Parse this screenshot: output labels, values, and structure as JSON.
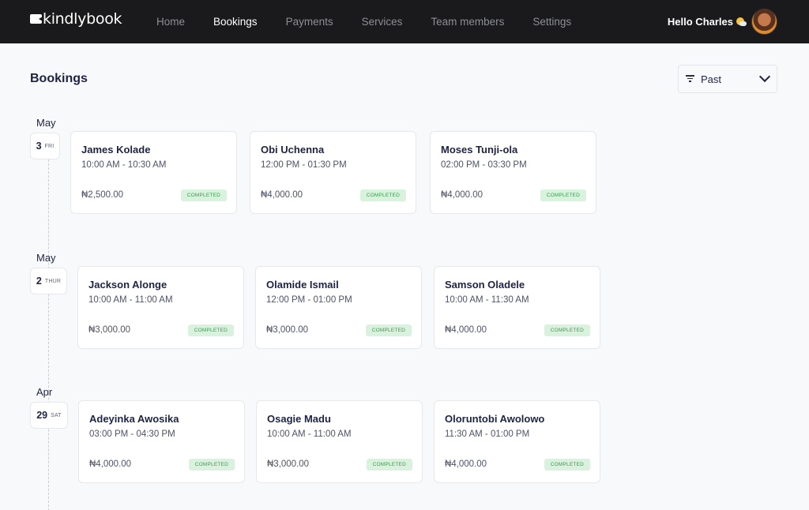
{
  "app": {
    "logo_text": "kindlybook",
    "greeting": "Hello Charles",
    "nav": [
      "Home",
      "Bookings",
      "Payments",
      "Services",
      "Team members",
      "Settings"
    ],
    "active_nav": "Bookings"
  },
  "page": {
    "title": "Bookings",
    "filter_label": "Past"
  },
  "groups": [
    {
      "month": "May",
      "date": "3",
      "weekday": "FRI",
      "bookings": [
        {
          "name": "James Kolade",
          "time": "10:00 AM - 10:30 AM",
          "price": "₦2,500.00",
          "status": "COMPLETED"
        },
        {
          "name": "Obi Uchenna",
          "time": "12:00 PM - 01:30 PM",
          "price": "₦4,000.00",
          "status": "COMPLETED"
        },
        {
          "name": "Moses Tunji-ola",
          "time": "02:00 PM - 03:30 PM",
          "price": "₦4,000.00",
          "status": "COMPLETED"
        }
      ]
    },
    {
      "month": "May",
      "date": "2",
      "weekday": "THUR",
      "bookings": [
        {
          "name": "Jackson Alonge",
          "time": "10:00 AM - 11:00 AM",
          "price": "₦3,000.00",
          "status": "COMPLETED"
        },
        {
          "name": "Olamide Ismail",
          "time": "12:00 PM - 01:00 PM",
          "price": "₦3,000.00",
          "status": "COMPLETED"
        },
        {
          "name": "Samson Oladele",
          "time": "10:00 AM - 11:30 AM",
          "price": "₦4,000.00",
          "status": "COMPLETED"
        }
      ]
    },
    {
      "month": "Apr",
      "date": "29",
      "weekday": "SAT",
      "bookings": [
        {
          "name": "Adeyinka Awosika",
          "time": "03:00 PM - 04:30 PM",
          "price": "₦4,000.00",
          "status": "COMPLETED"
        },
        {
          "name": "Osagie Madu",
          "time": "10:00 AM - 11:00 AM",
          "price": "₦3,000.00",
          "status": "COMPLETED"
        },
        {
          "name": "Oloruntobi Awolowo",
          "time": "11:30 AM - 01:00 PM",
          "price": "₦4,000.00",
          "status": "COMPLETED"
        }
      ]
    }
  ],
  "colors": {
    "nav_bg": "#1a1a1c",
    "badge_bg": "#d9f2dd",
    "badge_text": "#3c9a52"
  }
}
